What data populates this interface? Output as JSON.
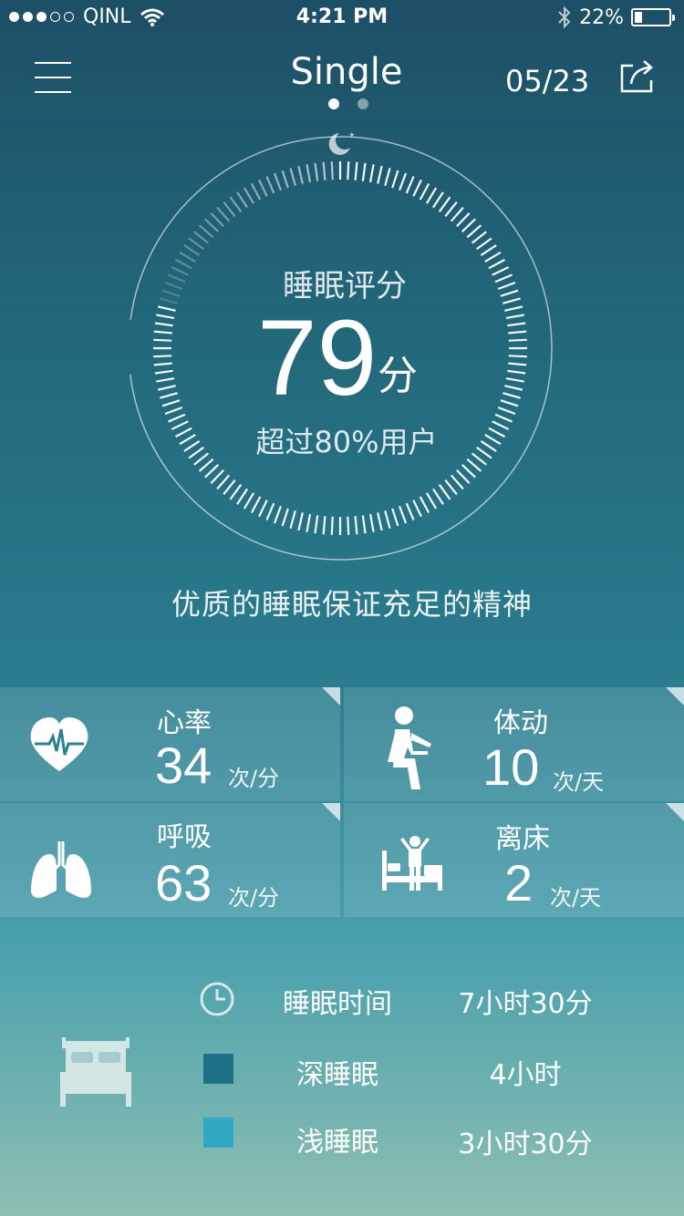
{
  "status_bar": {
    "carrier": "QINL",
    "time": "4:21 PM",
    "battery": "22%",
    "battery_level": 0.22
  },
  "header": {
    "title": "Single",
    "date": "05/23",
    "page_count": 2,
    "current_page": 1
  },
  "score": {
    "label": "睡眠评分",
    "value": "79",
    "unit": "分",
    "comparison": "超过80%用户",
    "fill": 0.79
  },
  "slogan": "优质的睡眠保证充足的精神",
  "metrics": [
    {
      "name": "心率",
      "value": "34",
      "unit": "次/分",
      "icon": "heart-rate-icon"
    },
    {
      "name": "体动",
      "value": "10",
      "unit": "次/天",
      "icon": "body-movement-icon"
    },
    {
      "name": "呼吸",
      "value": "63",
      "unit": "次/分",
      "icon": "lungs-icon"
    },
    {
      "name": "离床",
      "value": "2",
      "unit": "次/天",
      "icon": "out-of-bed-icon"
    }
  ],
  "summary": {
    "sleep_time": {
      "label": "睡眠时间",
      "value": "7小时30分",
      "icon": "clock-icon"
    },
    "deep_sleep": {
      "label": "深睡眠",
      "value": "4小时",
      "color": "#1f6f86"
    },
    "light_sleep": {
      "label": "浅睡眠",
      "value": "3小时30分",
      "color": "#30a8c4"
    }
  }
}
